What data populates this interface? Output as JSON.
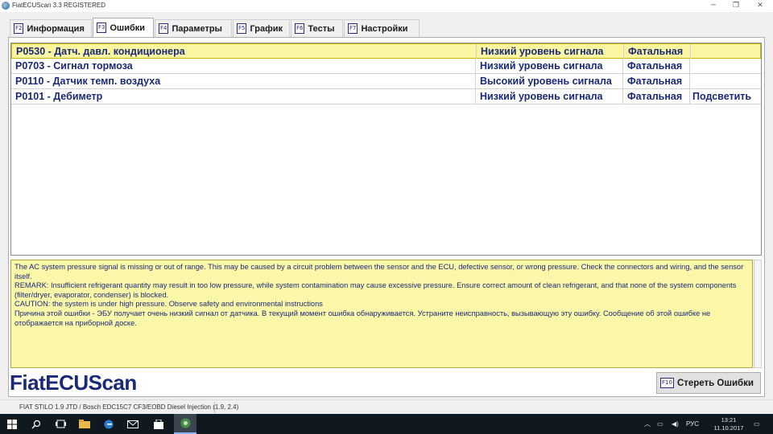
{
  "window": {
    "title": "FiatECUScan 3.3 REGISTERED",
    "controls": {
      "minimize": "─",
      "maximize": "❐",
      "close": "✕"
    }
  },
  "tabs": [
    {
      "key": "F2",
      "label": "Информация",
      "active": false
    },
    {
      "key": "F3",
      "label": "Ошибки",
      "active": true
    },
    {
      "key": "F4",
      "label": "Параметры",
      "active": false
    },
    {
      "key": "F5",
      "label": "График",
      "active": false
    },
    {
      "key": "F6",
      "label": "Тесты",
      "active": false
    },
    {
      "key": "F7",
      "label": "Настройки",
      "active": false
    }
  ],
  "errors": [
    {
      "code": "P0530 - Датч. давл. кондиционера",
      "status": "Низкий уровень сигнала",
      "severity": "Фатальная",
      "action": ""
    },
    {
      "code": "P0703 - Сигнал тормоза",
      "status": "Низкий уровень сигнала",
      "severity": "Фатальная",
      "action": ""
    },
    {
      "code": "P0110 - Датчик темп. воздуха",
      "status": "Высокий уровень сигнала",
      "severity": "Фатальная",
      "action": ""
    },
    {
      "code": "P0101 - Дебиметр",
      "status": "Низкий уровень сигнала",
      "severity": "Фатальная",
      "action": "Подсветить"
    }
  ],
  "description": [
    "The AC system pressure signal is missing or out of range. This may be caused by a circuit problem between the sensor and the ECU, defective sensor, or wrong pressure. Check the connectors and wiring, and the sensor itself.",
    "REMARK: Insufficient refrigerant quantity may result in too low pressure, while system contamination may cause excessive pressure. Ensure correct amount of clean refrigerant, and that none of the system components (filter/dryer, evaporator, condenser) is blocked.",
    "CAUTION: the system is under high pressure. Observe safety and environmental instructions",
    "Причина этой ошибки - ЭБУ получает очень низкий сигнал от датчика. В текущий момент ошибка обнаруживается. Устраните неисправность, вызывающую эту ошибку. Сообщение об этой ошибке не отображается на приборной доске."
  ],
  "logo": "FiatECUScan",
  "clear_button": {
    "key": "F10",
    "label": "Стереть Ошибки"
  },
  "status_bar": "FIAT STILO 1.9 JTD / Bosch EDC15C7 CF3/EOBD Diesel Injection (1.9, 2.4)",
  "taskbar": {
    "icons": [
      "windows-icon",
      "search-icon",
      "task-view-icon",
      "file-explorer-icon",
      "edge-icon",
      "mail-icon",
      "store-icon",
      "fiatecuscan-icon"
    ],
    "tray_glyphs": {
      "chevron": "︿",
      "network": "▭",
      "volume": "◀)",
      "notifications": "▭"
    },
    "language": "РУС",
    "time": "13:21",
    "date": "11.10.2017"
  },
  "colors": {
    "selected_row": "#faf5a0",
    "description_bg": "#fbf7a8",
    "text_navy": "#1a2a78"
  }
}
